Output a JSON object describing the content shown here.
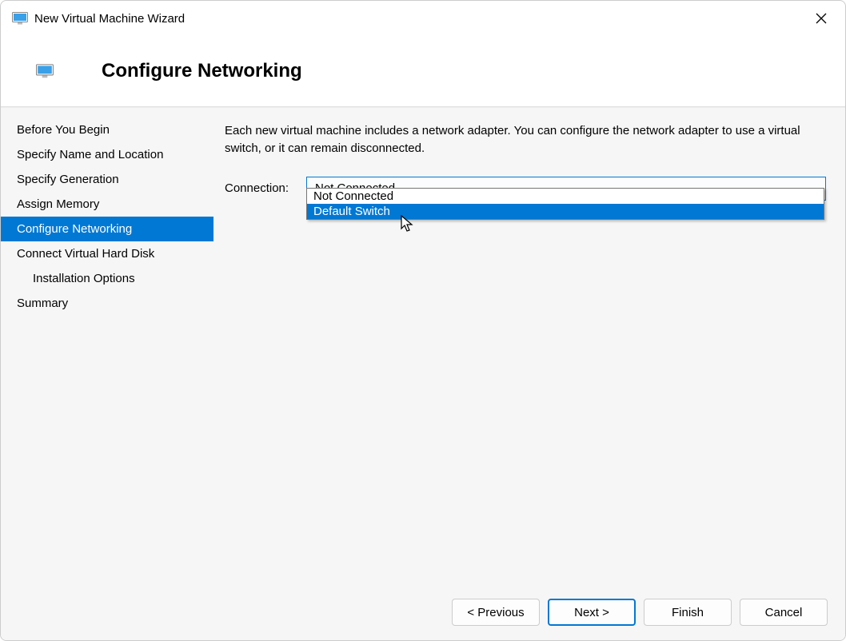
{
  "window": {
    "title": "New Virtual Machine Wizard"
  },
  "header": {
    "title": "Configure Networking"
  },
  "sidebar": {
    "items": [
      {
        "label": "Before You Begin",
        "active": false,
        "indent": false
      },
      {
        "label": "Specify Name and Location",
        "active": false,
        "indent": false
      },
      {
        "label": "Specify Generation",
        "active": false,
        "indent": false
      },
      {
        "label": "Assign Memory",
        "active": false,
        "indent": false
      },
      {
        "label": "Configure Networking",
        "active": true,
        "indent": false
      },
      {
        "label": "Connect Virtual Hard Disk",
        "active": false,
        "indent": false
      },
      {
        "label": "Installation Options",
        "active": false,
        "indent": true
      },
      {
        "label": "Summary",
        "active": false,
        "indent": false
      }
    ]
  },
  "main": {
    "description": "Each new virtual machine includes a network adapter. You can configure the network adapter to use a virtual switch, or it can remain disconnected.",
    "connection_label": "Connection:",
    "connection_value": "Not Connected",
    "dropdown_options": [
      {
        "label": "Not Connected",
        "highlight": false
      },
      {
        "label": "Default Switch",
        "highlight": true
      }
    ]
  },
  "footer": {
    "previous": "< Previous",
    "next": "Next >",
    "finish": "Finish",
    "cancel": "Cancel"
  }
}
